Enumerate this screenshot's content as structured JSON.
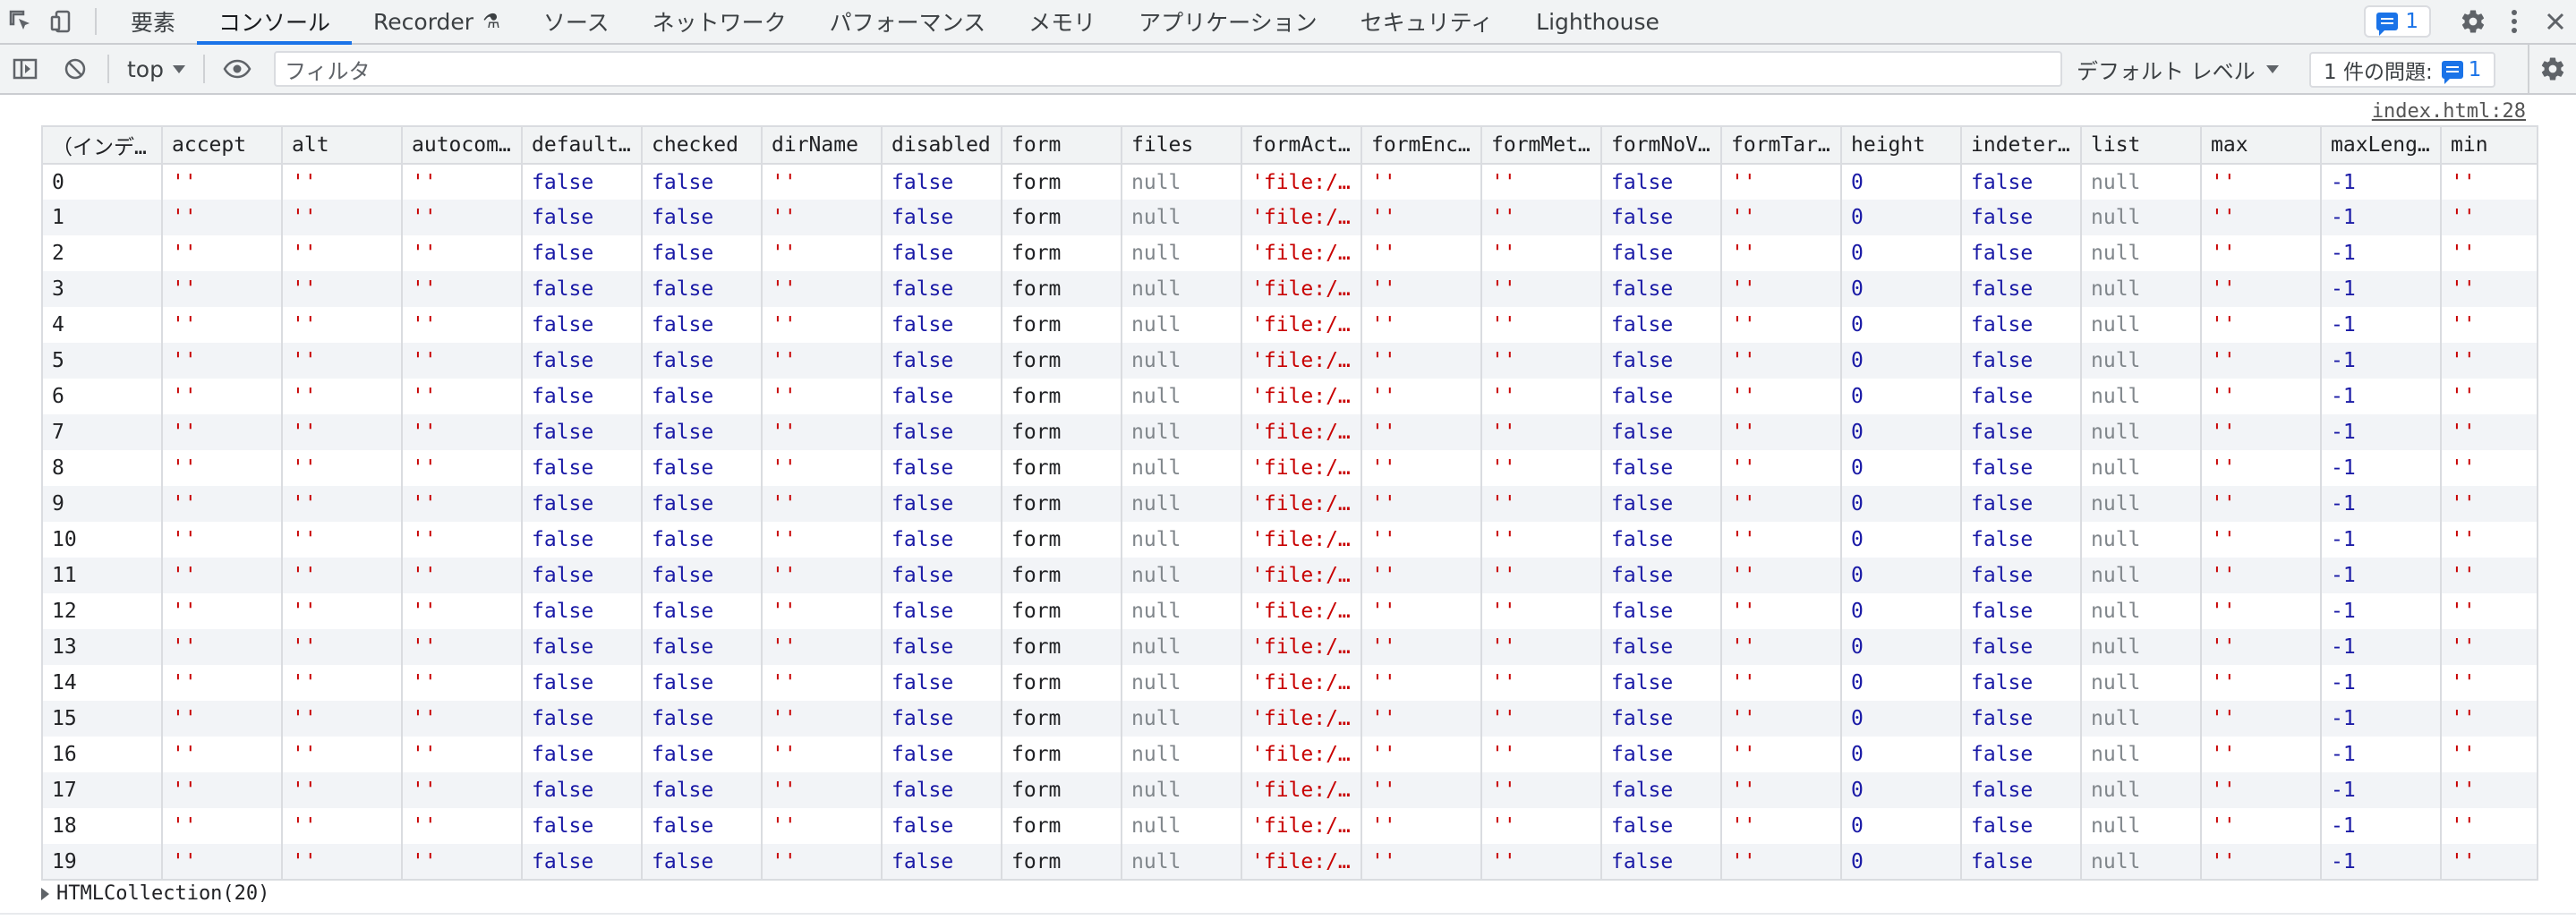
{
  "tabs": [
    {
      "label": "要素",
      "active": false
    },
    {
      "label": "コンソール",
      "active": true
    },
    {
      "label": "Recorder",
      "active": false,
      "icon": "flask-icon"
    },
    {
      "label": "ソース",
      "active": false
    },
    {
      "label": "ネットワーク",
      "active": false
    },
    {
      "label": "パフォーマンス",
      "active": false
    },
    {
      "label": "メモリ",
      "active": false
    },
    {
      "label": "アプリケーション",
      "active": false
    },
    {
      "label": "セキュリティ",
      "active": false
    },
    {
      "label": "Lighthouse",
      "active": false
    }
  ],
  "tabbar": {
    "issues_count": "1"
  },
  "console_toolbar": {
    "context": "top",
    "filter_placeholder": "フィルタ",
    "levels": "デフォルト レベル",
    "issues_label": "1 件の問題:",
    "issues_count": "1"
  },
  "colors": {
    "accent": "#1a73e8",
    "string": "#c80000",
    "keyword": "#1a1aa6",
    "null": "#80868b"
  },
  "console": {
    "source_link": "index.html:28",
    "collection_label": "HTMLCollection(20)",
    "table": {
      "columns": [
        "（インデ…",
        "accept",
        "alt",
        "autocom…",
        "default…",
        "checked",
        "dirName",
        "disabled",
        "form",
        "files",
        "formAct…",
        "formEnc…",
        "formMet…",
        "formNoV…",
        "formTar…",
        "height",
        "indeter…",
        "list",
        "max",
        "maxLeng…",
        "min"
      ],
      "row_values": [
        "''",
        "''",
        "''",
        "false",
        "false",
        "''",
        "false",
        "form",
        "null",
        "'file:/…",
        "''",
        "''",
        "false",
        "''",
        "0",
        "false",
        "null",
        "''",
        "-1",
        "''"
      ],
      "row_types": [
        "str",
        "str",
        "str",
        "bool",
        "bool",
        "str",
        "bool",
        "plain",
        "null",
        "str",
        "str",
        "str",
        "bool",
        "str",
        "num",
        "bool",
        "null",
        "str",
        "num",
        "str"
      ],
      "indices": [
        "0",
        "1",
        "2",
        "3",
        "4",
        "5",
        "6",
        "7",
        "8",
        "9",
        "10",
        "11",
        "12",
        "13",
        "14",
        "15",
        "16",
        "17",
        "18",
        "19"
      ]
    }
  }
}
